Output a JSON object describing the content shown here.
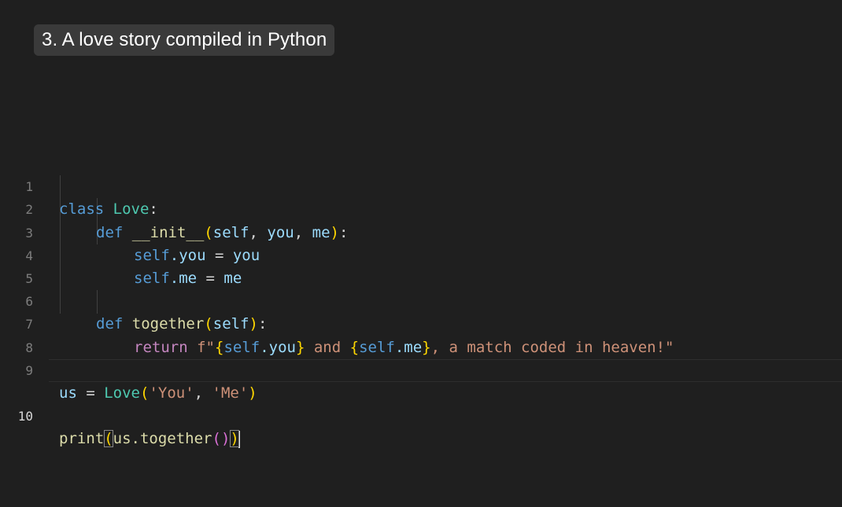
{
  "title": "3. A love story compiled in Python",
  "editor": {
    "line_numbers": [
      "1",
      "2",
      "3",
      "4",
      "5",
      "6",
      "7",
      "8",
      "9",
      "10"
    ],
    "active_line": "10",
    "lines": {
      "l1": [
        "class",
        " ",
        "Love",
        ":"
      ],
      "l2": [
        "def",
        " ",
        "__init__",
        "(",
        "self",
        ", ",
        "you",
        ", ",
        "me",
        ")",
        ":"
      ],
      "l3": [
        "self",
        ".you",
        " = ",
        "you"
      ],
      "l4": [
        "self",
        ".me",
        " = ",
        "me"
      ],
      "l6": [
        "def",
        " ",
        "together",
        "(",
        "self",
        ")",
        ":"
      ],
      "l7": [
        "return",
        " ",
        "f\"",
        "{",
        "self",
        ".you",
        "}",
        " and ",
        "{",
        "self",
        ".me",
        "}",
        ", a match coded in heaven!\""
      ],
      "l9": [
        "us",
        " = ",
        "Love",
        "(",
        "'You'",
        ", ",
        "'Me'",
        ")"
      ],
      "l10": [
        "print",
        "(",
        "us.together",
        "(",
        ")",
        ")"
      ]
    }
  }
}
